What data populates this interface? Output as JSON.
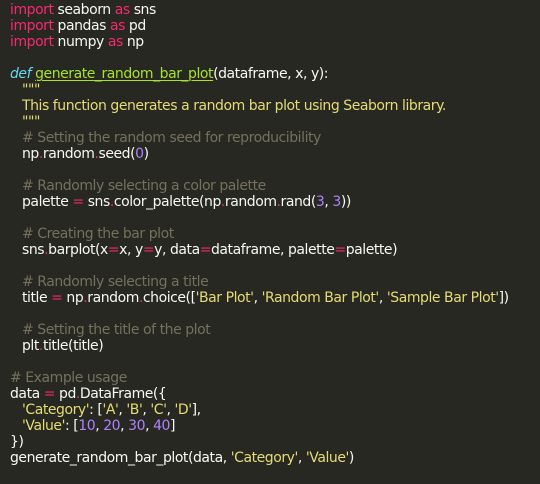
{
  "code": {
    "l01": {
      "a": "import",
      "b": " seaborn ",
      "c": "as",
      "d": " sns"
    },
    "l02": {
      "a": "import",
      "b": " pandas ",
      "c": "as",
      "d": " pd"
    },
    "l03": {
      "a": "import",
      "b": " numpy ",
      "c": "as",
      "d": " np"
    },
    "l05": {
      "a": "def",
      "b": " ",
      "c": "generate_random_bar_plot",
      "d": "(dataframe, x, y):"
    },
    "l06": {
      "a": "\"\"\""
    },
    "l07": {
      "a": "This function generates a random bar plot using Seaborn library."
    },
    "l08": {
      "a": "\"\"\""
    },
    "l09": {
      "a": "# Setting the random seed for reproducibility"
    },
    "l10": {
      "a": "np",
      "b": ".",
      "c": "random",
      "d": ".",
      "e": "seed(",
      "f": "0",
      "g": ")"
    },
    "l12": {
      "a": "# Randomly selecting a color palette"
    },
    "l13": {
      "a": "palette ",
      "b": "=",
      "c": " sns",
      "d": ".",
      "e": "color_palette(np",
      "f": ".",
      "g": "random",
      "h": ".",
      "i": "rand(",
      "j": "3",
      "k": ", ",
      "l": "3",
      "m": "))"
    },
    "l15": {
      "a": "# Creating the bar plot"
    },
    "l16": {
      "a": "sns",
      "b": ".",
      "c": "barplot(x",
      "d": "=",
      "e": "x, y",
      "f": "=",
      "g": "y, data",
      "h": "=",
      "i": "dataframe, palette",
      "j": "=",
      "k": "palette)"
    },
    "l18": {
      "a": "# Randomly selecting a title"
    },
    "l19": {
      "a": "title ",
      "b": "=",
      "c": " np",
      "d": ".",
      "e": "random",
      "f": ".",
      "g": "choice([",
      "h": "'Bar Plot'",
      "i": ", ",
      "j": "'Random Bar Plot'",
      "k": ", ",
      "l": "'Sample Bar Plot'",
      "m": "])"
    },
    "l21": {
      "a": "# Setting the title of the plot"
    },
    "l22": {
      "a": "plt",
      "b": ".",
      "c": "title(title)"
    },
    "l24": {
      "a": "# Example usage"
    },
    "l25": {
      "a": "data ",
      "b": "=",
      "c": " pd",
      "d": ".",
      "e": "DataFrame({"
    },
    "l26": {
      "a": "'Category'",
      "b": ": [",
      "c": "'A'",
      "d": ", ",
      "e": "'B'",
      "f": ", ",
      "g": "'C'",
      "h": ", ",
      "i": "'D'",
      "j": "],"
    },
    "l27": {
      "a": "'Value'",
      "b": ": [",
      "c": "10",
      "d": ", ",
      "e": "20",
      "f": ", ",
      "g": "30",
      "h": ", ",
      "i": "40",
      "j": "]"
    },
    "l28": {
      "a": "})"
    },
    "l29": {
      "a": "generate_random_bar_plot(data, ",
      "b": "'Category'",
      "c": ", ",
      "d": "'Value'",
      "e": ")"
    }
  },
  "colors": {
    "background": "#272822",
    "keyword": "#f92672",
    "def_keyword": "#66d9ef",
    "function_name": "#a6e22e",
    "string": "#e6db74",
    "number": "#ae81ff",
    "comment": "#75715e",
    "text": "#f8f8f2"
  }
}
